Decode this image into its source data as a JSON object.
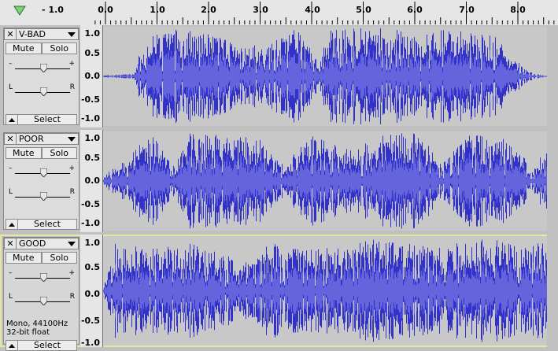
{
  "ruler": {
    "ticks": [
      "- 1.0",
      "0.0",
      "1.0",
      "2.0",
      "3.0",
      "4.0",
      "5.0",
      "6.0",
      "7.0",
      "8.0"
    ],
    "play_icon": "triangle-down-icon"
  },
  "tracks": [
    {
      "name": "V-BAD",
      "mute_label": "Mute",
      "solo_label": "Solo",
      "gain_minus": "–",
      "gain_plus": "+",
      "pan_left": "L",
      "pan_right": "R",
      "select_label": "Select",
      "scale": [
        "1.0",
        "0.5",
        "0.0",
        "-0.5",
        "-1.0"
      ],
      "selected": false,
      "info_line1": "",
      "info_line2": ""
    },
    {
      "name": "POOR",
      "mute_label": "Mute",
      "solo_label": "Solo",
      "gain_minus": "–",
      "gain_plus": "+",
      "pan_left": "L",
      "pan_right": "R",
      "select_label": "Select",
      "scale": [
        "1.0",
        "0.5",
        "0.0",
        "-0.5",
        "-1.0"
      ],
      "selected": false,
      "info_line1": "",
      "info_line2": ""
    },
    {
      "name": "GOOD",
      "mute_label": "Mute",
      "solo_label": "Solo",
      "gain_minus": "–",
      "gain_plus": "+",
      "pan_left": "L",
      "pan_right": "R",
      "select_label": "Select",
      "scale": [
        "1.0",
        "0.5",
        "0.0",
        "-0.5",
        "-1.0"
      ],
      "selected": true,
      "info_line1": "Mono, 44100Hz",
      "info_line2": "32-bit float"
    }
  ],
  "colors": {
    "waveform": "#3232c8",
    "waveform_rms": "#6464dc",
    "waveform_bg": "#c8c8c8",
    "selection_border": "#e8e6a0"
  }
}
